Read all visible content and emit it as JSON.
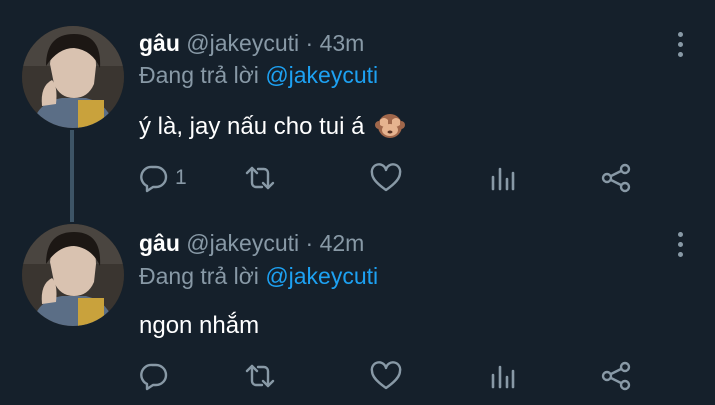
{
  "tweets": [
    {
      "name": "gâu",
      "handle": "@jakeycuti",
      "separator": "·",
      "time": "43m",
      "replying_prefix": "Đang trả lời",
      "replying_to": "@jakeycuti",
      "text": "ý là, jay nấu cho tui á",
      "emoji": "see-no-evil-monkey",
      "reply_count": "1"
    },
    {
      "name": "gâu",
      "handle": "@jakeycuti",
      "separator": "·",
      "time": "42m",
      "replying_prefix": "Đang trả lời",
      "replying_to": "@jakeycuti",
      "text": "ngon nhắm",
      "reply_count": ""
    }
  ],
  "colors": {
    "background": "#15202b",
    "muted": "#8899a6",
    "accent": "#1da1f2",
    "thread_line": "#3d5466"
  },
  "icons": [
    "reply-icon",
    "retweet-icon",
    "like-icon",
    "stats-icon",
    "share-icon",
    "more-icon"
  ]
}
